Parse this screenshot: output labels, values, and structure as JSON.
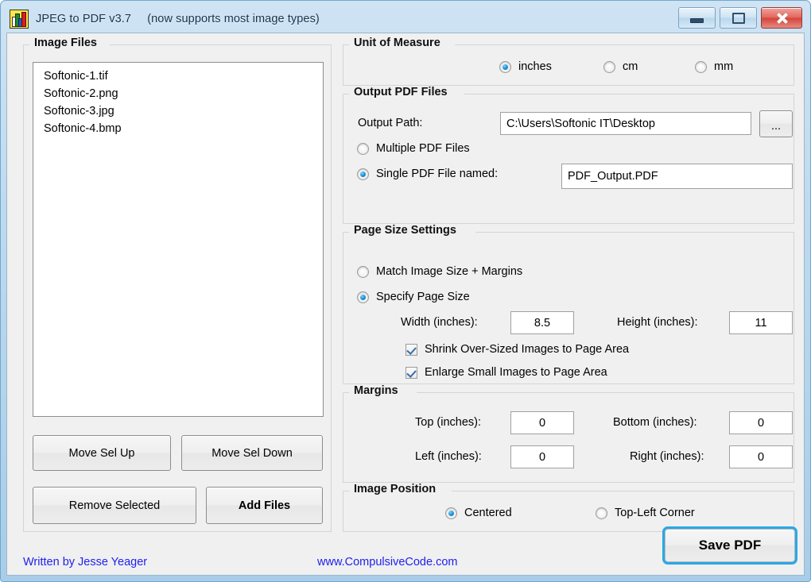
{
  "window": {
    "title": "JPEG to PDF  v3.7",
    "subtitle": "(now supports most image types)",
    "icon": "chart-bars-icon",
    "controls": {
      "minimize": "minimize-icon",
      "maximize": "maximize-icon",
      "close": "close-icon"
    }
  },
  "image_files": {
    "legend": "Image Files",
    "items": [
      "Softonic-1.tif",
      "Softonic-2.png",
      "Softonic-3.jpg",
      "Softonic-4.bmp"
    ],
    "buttons": {
      "move_up": "Move Sel Up",
      "move_down": "Move Sel Down",
      "remove": "Remove Selected",
      "add": "Add Files"
    }
  },
  "unit_of_measure": {
    "legend": "Unit of Measure",
    "options": [
      {
        "label": "inches",
        "selected": true
      },
      {
        "label": "cm",
        "selected": false
      },
      {
        "label": "mm",
        "selected": false
      }
    ]
  },
  "output_pdf_files": {
    "legend": "Output PDF Files",
    "output_path_label": "Output Path:",
    "output_path_value": "C:\\Users\\Softonic IT\\Desktop",
    "browse_label": "...",
    "multiple_label": "Multiple PDF Files",
    "multiple_selected": false,
    "single_label": "Single PDF File named:",
    "single_selected": true,
    "single_filename": "PDF_Output.PDF"
  },
  "page_size_settings": {
    "legend": "Page Size Settings",
    "match_label": "Match Image Size + Margins",
    "match_selected": false,
    "specify_label": "Specify Page Size",
    "specify_selected": true,
    "width_label": "Width (inches):",
    "width_value": "8.5",
    "height_label": "Height (inches):",
    "height_value": "11",
    "shrink_label": "Shrink Over-Sized Images to Page Area",
    "shrink_checked": true,
    "enlarge_label": "Enlarge Small Images to Page Area",
    "enlarge_checked": true
  },
  "margins": {
    "legend": "Margins",
    "top_label": "Top (inches):",
    "top_value": "0",
    "bottom_label": "Bottom (inches):",
    "bottom_value": "0",
    "left_label": "Left (inches):",
    "left_value": "0",
    "right_label": "Right (inches):",
    "right_value": "0"
  },
  "image_position": {
    "legend": "Image Position",
    "centered_label": "Centered",
    "centered_selected": true,
    "topleft_label": "Top-Left Corner",
    "topleft_selected": false
  },
  "footer": {
    "author": "Written by Jesse Yeager",
    "website": "www.CompulsiveCode.com",
    "save_label": "Save PDF"
  },
  "colors": {
    "accent_blue": "#1b8fd6",
    "link_blue": "#2020ee",
    "focus_ring": "#2aa8e8",
    "title_gradient_top": "#cfe3f3",
    "client_bg": "#f0f0f0"
  }
}
